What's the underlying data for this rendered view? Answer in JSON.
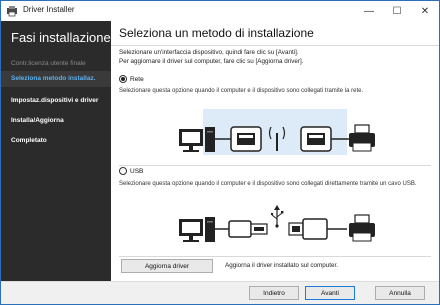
{
  "window": {
    "title": "Driver Installer",
    "controls": {
      "minimize": "—",
      "maximize": "☐",
      "close": "✕"
    }
  },
  "sidebar": {
    "title": "Fasi installazione",
    "items": [
      {
        "label": "Contr.licenza utente finale",
        "state": "done"
      },
      {
        "label": "Seleziona metodo installaz.",
        "state": "current"
      },
      {
        "label": "Impostaz.dispositivi e driver",
        "state": "pending"
      },
      {
        "label": "Installa/Aggiorna",
        "state": "pending"
      },
      {
        "label": "Completato",
        "state": "pending"
      }
    ]
  },
  "main": {
    "title": "Seleziona un metodo di installazione",
    "intro_line1": "Selezionare un'interfaccia dispositivo, quindi fare clic su [Avanti].",
    "intro_line2": "Per aggiornare il driver sul computer, fare clic su [Aggiorna driver].",
    "options": [
      {
        "label": "Rete",
        "selected": true,
        "description": "Selezionare questa opzione quando il computer e il dispositivo sono collegati tramite la rete."
      },
      {
        "label": "USB",
        "selected": false,
        "description": "Selezionare questa opzione quando il computer e il dispositivo sono collegati direttamente tramite un cavo USB."
      }
    ],
    "update_driver_button": "Aggiorna driver",
    "update_driver_note": "Aggiorna il driver installato sul computer."
  },
  "footer": {
    "back_button": "Indietro",
    "next_button": "Avanti",
    "cancel_button": "Annulla"
  },
  "colors": {
    "sidebar_bg": "#2b2b2b",
    "active_step": "#5ab0f0",
    "network_highlight": "#dcebf7",
    "primary_border": "#1e7ad8"
  }
}
